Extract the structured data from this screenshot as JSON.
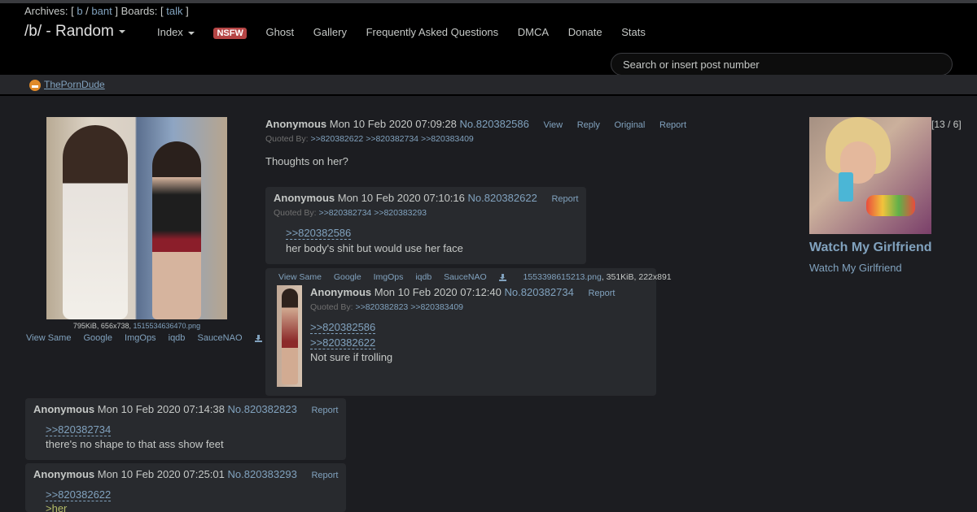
{
  "header": {
    "archives_label": "Archives: [",
    "archive_links": [
      "b",
      "bant"
    ],
    "archives_close": "]",
    "boards_label": "Boards: [",
    "board_links": [
      "talk"
    ],
    "boards_close": "]",
    "board_title": "/b/ - Random",
    "nav": {
      "index": "Index",
      "nsfw_badge": "NSFW",
      "items": [
        "Ghost",
        "Gallery",
        "Frequently Asked Questions",
        "DMCA",
        "Donate",
        "Stats"
      ]
    },
    "search_placeholder": "Search or insert post number"
  },
  "sponsor": {
    "label": "ThePornDude"
  },
  "op": {
    "file_info_prefix": "795KiB, 656x738,",
    "file_name": "1515534636470.png",
    "tools": [
      "View Same",
      "Google",
      "ImgOps",
      "iqdb",
      "SauceNAO"
    ],
    "name": "Anonymous",
    "date": "Mon 10 Feb 2020 07:09:28",
    "number": "No.820382586",
    "controls": [
      "View",
      "Reply",
      "Original",
      "Report"
    ],
    "quoted_label": "Quoted By:",
    "quoted_by": [
      ">>820382622",
      ">>820382734",
      ">>820383409"
    ],
    "text": "Thoughts on her?"
  },
  "replies": [
    {
      "name": "Anonymous",
      "date": "Mon 10 Feb 2020 07:10:16",
      "number": "No.820382622",
      "report": "Report",
      "quoted_label": "Quoted By:",
      "quoted_by": [
        ">>820382734",
        ">>820383293"
      ],
      "quote_links": [
        ">>820382586"
      ],
      "text": "her body's shit but would use her face"
    },
    {
      "tools": [
        "View Same",
        "Google",
        "ImgOps",
        "iqdb",
        "SauceNAO"
      ],
      "file_name": "1553398615213.png",
      "file_info": ", 351KiB, 222x891",
      "name": "Anonymous",
      "date": "Mon 10 Feb 2020 07:12:40",
      "number": "No.820382734",
      "report": "Report",
      "quoted_label": "Quoted By:",
      "quoted_by": [
        ">>820382823",
        ">>820383409"
      ],
      "quote_links": [
        ">>820382586",
        ">>820382622"
      ],
      "text": "Not sure if trolling"
    },
    {
      "name": "Anonymous",
      "date": "Mon 10 Feb 2020 07:14:38",
      "number": "No.820382823",
      "report": "Report",
      "quote_links": [
        ">>820382734"
      ],
      "text": "there's no shape to that ass show feet"
    },
    {
      "name": "Anonymous",
      "date": "Mon 10 Feb 2020 07:25:01",
      "number": "No.820383293",
      "report": "Report",
      "quote_links": [
        ">>820382622"
      ],
      "greentext": ">her"
    }
  ],
  "ad": {
    "counter": "[13 / 6]",
    "title": "Watch My Girlfriend",
    "subtitle": "Watch My Girlfriend"
  }
}
